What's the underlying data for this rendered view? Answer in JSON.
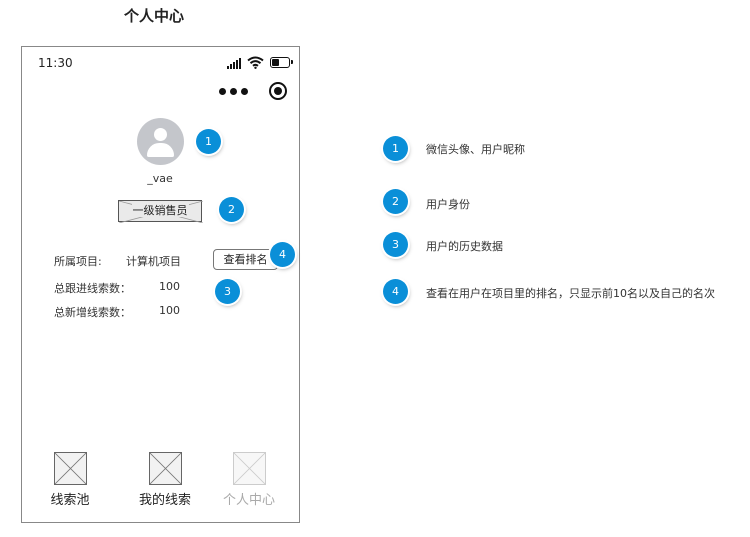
{
  "page_title": "个人中心",
  "phone": {
    "status": {
      "time": "11:30",
      "battery_level": 0.45
    },
    "profile": {
      "nickname": "_vae",
      "role": "一级销售员"
    },
    "info": {
      "project_label": "所属项目:",
      "project_value": "计算机项目",
      "rank_button": "查看排名",
      "followed_label": "总跟进线索数：",
      "followed_value": "100",
      "new_label": "总新增线索数：",
      "new_value": "100"
    },
    "tabs": [
      {
        "label": "线索池",
        "active": true
      },
      {
        "label": "我的线索",
        "active": true
      },
      {
        "label": "个人中心",
        "active": false
      }
    ]
  },
  "markers": [
    "1",
    "2",
    "3",
    "4"
  ],
  "notes": [
    {
      "num": "1",
      "text": "微信头像、用户昵称"
    },
    {
      "num": "2",
      "text": "用户身份"
    },
    {
      "num": "3",
      "text": "用户的历史数据"
    },
    {
      "num": "4",
      "text": "查看在用户在项目里的排名，只显示前10名以及自己的名次"
    }
  ],
  "colors": {
    "badge": "#0a8fd8",
    "avatar": "#c4c6cb",
    "inactive_tab": "#aaaaaa"
  }
}
